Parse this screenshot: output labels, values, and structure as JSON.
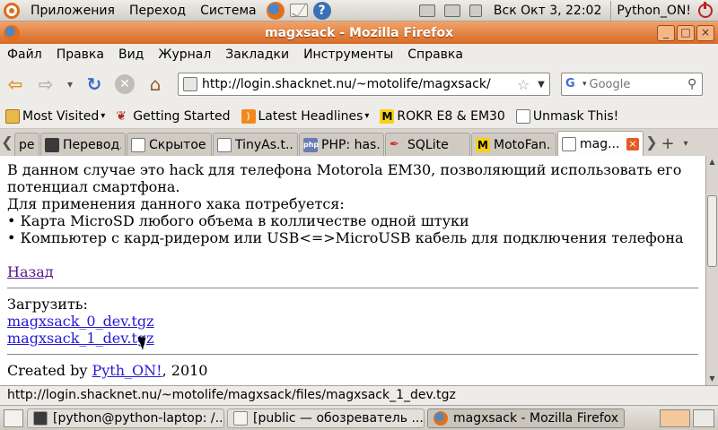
{
  "top_panel": {
    "menus": [
      "Приложения",
      "Переход",
      "Система"
    ],
    "clock": "Вск Окт  3, 22:02",
    "user": "Python_ON!"
  },
  "window": {
    "title": "magxsack - Mozilla Firefox"
  },
  "menubar": [
    "Файл",
    "Правка",
    "Вид",
    "Журнал",
    "Закладки",
    "Инструменты",
    "Справка"
  ],
  "navbar": {
    "url": "http://login.shacknet.nu/~motolife/magxsack/",
    "search_placeholder": "Google"
  },
  "bookmarks": [
    {
      "label": "Most Visited",
      "icon": "most-visited-icon",
      "dropdown": true
    },
    {
      "label": "Getting Started",
      "icon": "getting-started-icon",
      "dropdown": false
    },
    {
      "label": "Latest Headlines",
      "icon": "rss-icon",
      "dropdown": true
    },
    {
      "label": "ROKR E8 & EM30",
      "icon": "motorola-icon",
      "dropdown": false
    },
    {
      "label": "Unmask This!",
      "icon": "page-icon",
      "dropdown": false
    }
  ],
  "tabs": [
    {
      "label": "ре...",
      "active": false
    },
    {
      "label": "Перевод...",
      "active": false
    },
    {
      "label": "Скрытое...",
      "active": false
    },
    {
      "label": "TinyAs.t...",
      "active": false
    },
    {
      "label": "PHP: has...",
      "active": false
    },
    {
      "label": "SQLite",
      "active": false
    },
    {
      "label": "MotoFan...",
      "active": false
    },
    {
      "label": "mag...",
      "active": true
    }
  ],
  "page": {
    "line1": "В данном случае это hack для телефона Motorola EM30, позволяющий использовать его",
    "line2": "потенциал смартфона.",
    "line3": "Для применения данного хака потребуется:",
    "bullet1": "• Карта MicroSD любого объема в колличестве одной штуки",
    "bullet2": "• Компьютер с кард-ридером или USB<=>MicroUSB кабель для подключения телефона",
    "back_link": "Назад",
    "download_label": "Загрузить:",
    "file1": "magxsack_0_dev.tgz",
    "file2": "magxsack_1_dev.tgz",
    "footer_prefix": "Created by ",
    "footer_link": "Pyth_ON!",
    "footer_suffix": ", 2010"
  },
  "statusbar": "http://login.shacknet.nu/~motolife/magxsack/files/magxsack_1_dev.tgz",
  "taskbar": [
    {
      "label": "[python@python-laptop: /...",
      "active": false
    },
    {
      "label": "[public — обозреватель ...",
      "active": false
    },
    {
      "label": "magxsack - Mozilla Firefox",
      "active": true
    }
  ]
}
